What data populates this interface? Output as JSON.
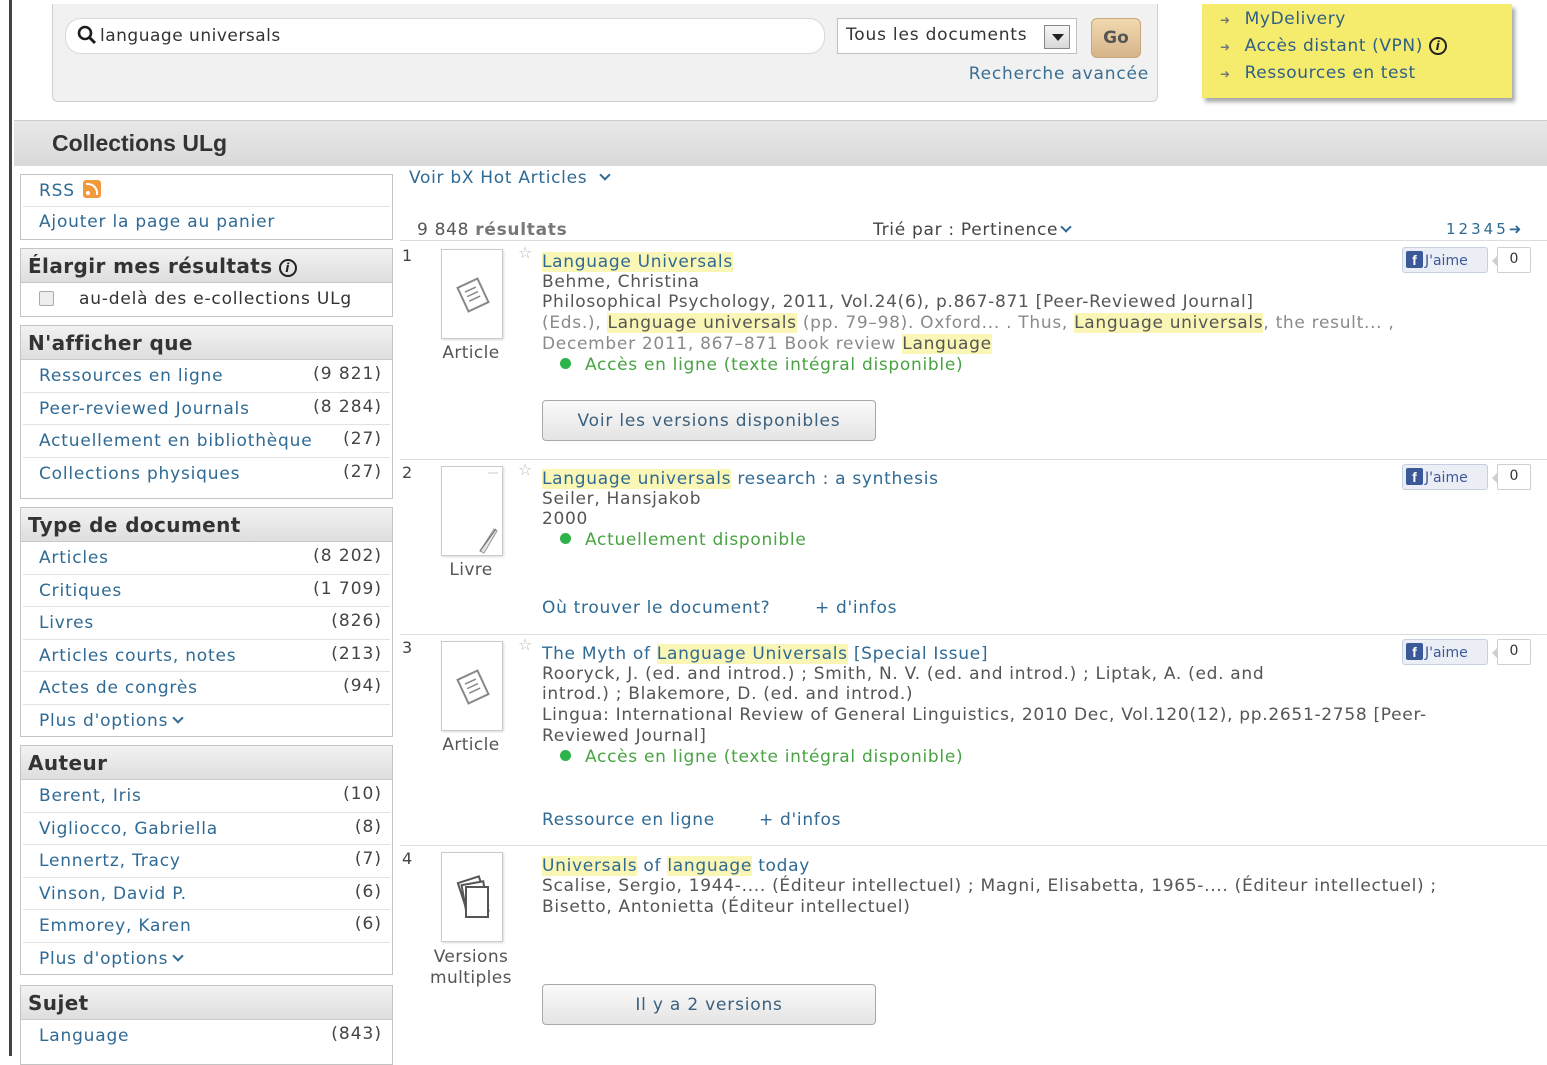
{
  "search": {
    "query": "language universals",
    "scope_selected": "Tous les documents",
    "go_label": "Go",
    "advanced_label": "Recherche avancée"
  },
  "quick_links": [
    {
      "label": "MyDelivery"
    },
    {
      "label": "Accès distant (VPN)"
    },
    {
      "label": "Ressources en test"
    }
  ],
  "collections_title": "Collections ULg",
  "sidebar": {
    "top_links": [
      {
        "label": "RSS"
      },
      {
        "label": "Ajouter la page au panier"
      }
    ],
    "expand": {
      "title": "Élargir mes résultats",
      "option": "au-delà des e-collections ULg"
    },
    "show_only": {
      "title": "N'afficher que",
      "items": [
        {
          "label": "Ressources en ligne",
          "count": "(9 821)"
        },
        {
          "label": "Peer-reviewed Journals",
          "count": "(8 284)"
        },
        {
          "label": "Actuellement en bibliothèque",
          "count": "(27)"
        },
        {
          "label": "Collections physiques",
          "count": "(27)"
        }
      ]
    },
    "doc_type": {
      "title": "Type de document",
      "items": [
        {
          "label": "Articles",
          "count": "(8 202)"
        },
        {
          "label": "Critiques",
          "count": "(1 709)"
        },
        {
          "label": "Livres",
          "count": "(826)"
        },
        {
          "label": "Articles courts, notes",
          "count": "(213)"
        },
        {
          "label": "Actes de congrès",
          "count": "(94)"
        }
      ],
      "more": "Plus d'options"
    },
    "author": {
      "title": "Auteur",
      "items": [
        {
          "label": "Berent, Iris",
          "count": "(10)"
        },
        {
          "label": "Vigliocco, Gabriella",
          "count": "(8)"
        },
        {
          "label": "Lennertz, Tracy",
          "count": "(7)"
        },
        {
          "label": "Vinson, David P.",
          "count": "(6)"
        },
        {
          "label": "Emmorey, Karen",
          "count": "(6)"
        }
      ],
      "more": "Plus d'options"
    },
    "subject": {
      "title": "Sujet",
      "items": [
        {
          "label": "Language",
          "count": "(843)"
        }
      ]
    }
  },
  "results_header": {
    "hot_articles": "Voir bX Hot Articles",
    "count_number": "9 848",
    "count_word": "résultats",
    "sort_label": "Trié par :",
    "sort_value": "Pertinence",
    "pages": [
      "1",
      "2",
      "3",
      "4",
      "5"
    ]
  },
  "facebook": {
    "like_label": "J'aime",
    "count": "0"
  },
  "results": [
    {
      "number": "1",
      "type": "Article",
      "title_hl1": "Language Universals",
      "author": "Behme, Christina",
      "source": "Philosophical Psychology, 2011, Vol.24(6), p.867-871 [Peer-Reviewed Journal]",
      "snippet_a": "(Eds.),",
      "snippet_hl1": "Language universals",
      "snippet_b": "(pp. 79–98). Oxford... . Thus,",
      "snippet_hl2": "Language universals",
      "snippet_c": ", the result... ,",
      "snippet2_a": "December 2011, 867–871 Book review",
      "snippet2_hl": "Language",
      "availability": "Accès en ligne (texte intégral disponible)",
      "button": "Voir les versions disponibles"
    },
    {
      "number": "2",
      "type": "Livre",
      "title_hl1": "Language universals",
      "title_rest": "research : a synthesis",
      "author": "Seiler, Hansjakob",
      "source": "2000",
      "availability": "Actuellement disponible",
      "link1": "Où trouver le document?",
      "link2": "+ d'infos"
    },
    {
      "number": "3",
      "type": "Article",
      "title_pre": "The Myth of",
      "title_hl1": "Language Universals",
      "title_rest": "[Special Issue]",
      "author_line1": "Rooryck, J. (ed. and introd.) ; Smith, N. V. (ed. and introd.) ; Liptak, A. (ed. and",
      "author_line2": "introd.) ; Blakemore, D. (ed. and introd.)",
      "source_line1": "Lingua: International Review of General Linguistics, 2010 Dec, Vol.120(12), pp.2651-2758 [Peer-",
      "source_line2": "Reviewed Journal]",
      "availability": "Accès en ligne (texte intégral disponible)",
      "link1": "Ressource en ligne",
      "link2": "+ d'infos"
    },
    {
      "number": "4",
      "type_line1": "Versions",
      "type_line2": "multiples",
      "title_hl1": "Universals",
      "title_mid": "of",
      "title_hl2": "language",
      "title_rest": "today",
      "author_line1": "Scalise, Sergio, 1944-.... (Éditeur intellectuel) ; Magni, Elisabetta, 1965-.... (Éditeur intellectuel) ;",
      "author_line2": "Bisetto, Antonietta (Éditeur intellectuel)",
      "button": "Il y a 2 versions"
    }
  ]
}
